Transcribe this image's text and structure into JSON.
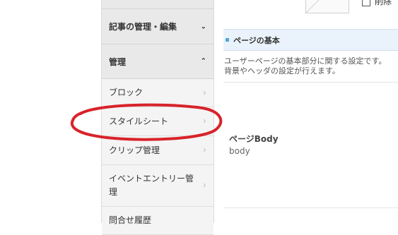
{
  "sidebar": {
    "sections": [
      {
        "label": "記事の管理・編集",
        "chevron": "chevron-down-icon"
      },
      {
        "label": "管理",
        "chevron": "chevron-up-icon"
      }
    ],
    "items": [
      {
        "label": "ブロック"
      },
      {
        "label": "スタイルシート"
      },
      {
        "label": "クリップ管理"
      },
      {
        "label": "イベントエントリー管理"
      },
      {
        "label": "問合せ履歴"
      }
    ]
  },
  "header": {
    "delete_label": "削除"
  },
  "main": {
    "section_title": "ページの基本",
    "description_lines": [
      "ユーザーページの基本部分に関する設定です。",
      "背景やヘッダの設定が行えます。"
    ],
    "field": {
      "label": "ページBody",
      "value": "body"
    }
  },
  "colors": {
    "accent": "#4fa6d8",
    "annotation": "#d8232a",
    "section_bg": "#eaf3fb"
  }
}
